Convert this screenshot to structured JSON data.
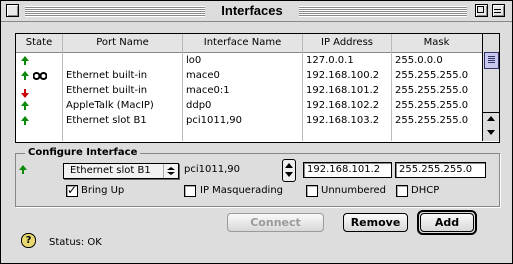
{
  "window": {
    "title": "Interfaces"
  },
  "table": {
    "columns": [
      "State",
      "Port Name",
      "Interface Name",
      "IP Address",
      "Mask"
    ],
    "rows": [
      {
        "state": "up",
        "port": "",
        "iface": "lo0",
        "ip": "127.0.0.1",
        "mask": "255.0.0.0"
      },
      {
        "state": "up-link",
        "port": "Ethernet built-in",
        "iface": "mace0",
        "ip": "192.168.100.2",
        "mask": "255.255.255.0"
      },
      {
        "state": "down",
        "port": "Ethernet built-in",
        "iface": "mace0:1",
        "ip": "192.168.101.2",
        "mask": "255.255.255.0"
      },
      {
        "state": "up",
        "port": "AppleTalk (MacIP)",
        "iface": "ddp0",
        "ip": "192.168.102.2",
        "mask": "255.255.255.0"
      },
      {
        "state": "up",
        "port": "Ethernet slot B1",
        "iface": "pci1011,90",
        "ip": "192.168.103.2",
        "mask": "255.255.255.0"
      }
    ]
  },
  "configure": {
    "group_label": "Configure Interface",
    "port_selected": "Ethernet slot B1",
    "iface_name": "pci1011,90",
    "ip_value": "192.168.101.2",
    "mask_value": "255.255.255.0",
    "checkboxes": {
      "bring_up": {
        "label": "Bring Up",
        "checked": true
      },
      "ip_masq": {
        "label": "IP Masquerading",
        "checked": false
      },
      "unnumbered": {
        "label": "Unnumbered",
        "checked": false
      },
      "dhcp": {
        "label": "DHCP",
        "checked": false
      }
    }
  },
  "buttons": {
    "connect": "Connect",
    "remove": "Remove",
    "add": "Add"
  },
  "status": {
    "label": "Status",
    "value": "OK",
    "text": "Status: OK"
  },
  "colors": {
    "up": "#0a8a0a",
    "down": "#cc0000",
    "window_bg": "#dddddd"
  }
}
